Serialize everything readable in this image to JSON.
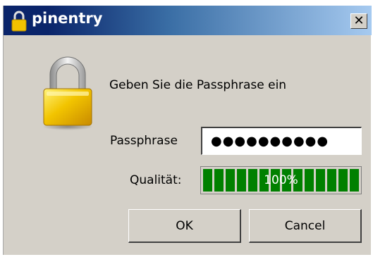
{
  "window": {
    "title": "pinentry",
    "close_label": "✕"
  },
  "dialog": {
    "message": "Geben Sie die Passphrase ein",
    "passphrase_label": "Passphrase",
    "passphrase_value": "●●●●●●●●●●",
    "quality_label": "Qualität:",
    "quality_value": "100%",
    "quality_fraction": 1.0
  },
  "buttons": {
    "ok": "OK",
    "cancel": "Cancel"
  },
  "colors": {
    "title_dark": "#0a246a",
    "title_light": "#a6caf0",
    "progress": "#008000",
    "face": "#d4d0c8"
  },
  "icons": {
    "title": "lock-icon",
    "dialog": "padlock-icon"
  }
}
